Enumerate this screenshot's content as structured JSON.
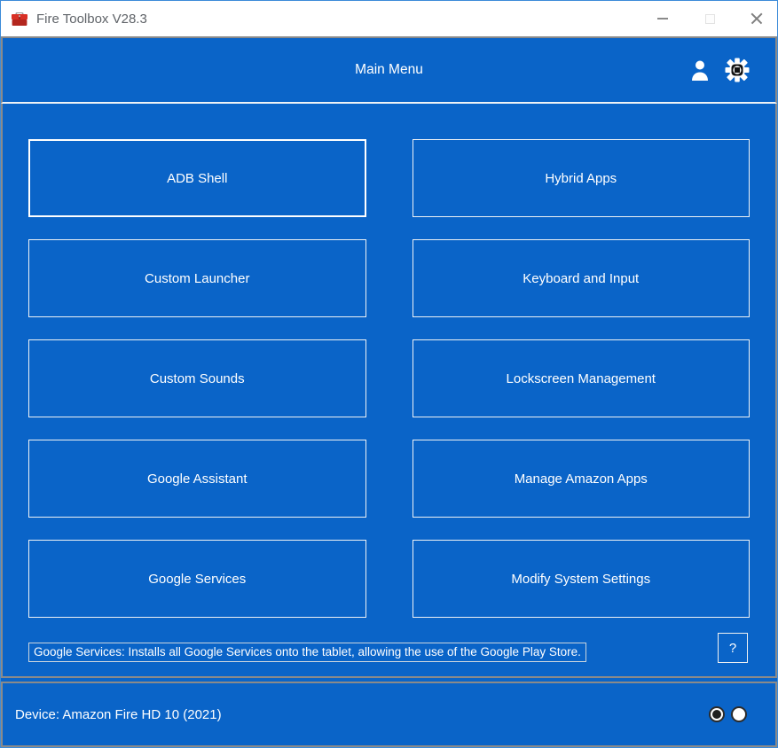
{
  "window": {
    "title": "Fire Toolbox V28.3",
    "app_icon": "toolbox-icon",
    "control_icons": [
      "minimize-icon",
      "maximize-icon",
      "close-icon"
    ]
  },
  "header": {
    "title": "Main Menu",
    "icons": [
      "user-icon",
      "gear-icon"
    ]
  },
  "menu": {
    "left_buttons": [
      "ADB Shell",
      "Custom Launcher",
      "Custom Sounds",
      "Google Assistant",
      "Google Services"
    ],
    "right_buttons": [
      "Hybrid Apps",
      "Keyboard and Input",
      "Lockscreen Management",
      "Manage Amazon Apps",
      "Modify System Settings"
    ],
    "focused_button": "ADB Shell"
  },
  "status": {
    "description": "Google Services: Installs all Google Services onto the tablet, allowing the use of the Google Play Store.",
    "help_label": "?"
  },
  "footer": {
    "device": "Device: Amazon Fire HD 10 (2021)",
    "indicators": [
      {
        "name": "indicator-left",
        "selected": true
      },
      {
        "name": "indicator-right",
        "selected": false
      }
    ]
  },
  "colors": {
    "panel_blue": "#0a64c8",
    "panel_border_gray": "#8a8a8a",
    "button_border_white": "#eef2f6",
    "titlebar_text": "#5f6368",
    "toolbox_red": "#c62a22"
  }
}
